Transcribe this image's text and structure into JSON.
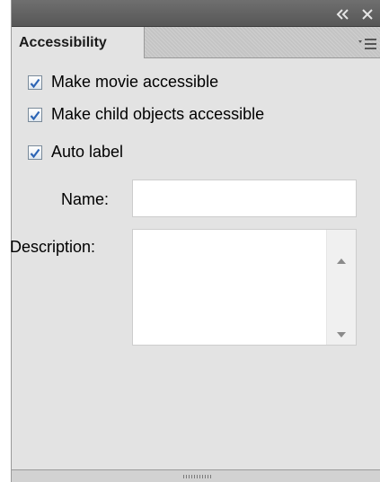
{
  "panel": {
    "tab_label": "Accessibility",
    "titlebar_icons": [
      "collapse-icon",
      "close-icon"
    ],
    "menu_icon": "panel-menu-icon"
  },
  "checkboxes": [
    {
      "label": "Make movie accessible",
      "checked": true
    },
    {
      "label": "Make child objects accessible",
      "checked": true
    },
    {
      "label": "Auto label",
      "checked": true
    }
  ],
  "fields": {
    "name_label": "Name:",
    "name_value": "",
    "description_label": "Description:",
    "description_value": ""
  },
  "colors": {
    "titlebar": "#636363",
    "panel_bg": "#e3e3e3",
    "check_mark": "#2b64b5"
  }
}
